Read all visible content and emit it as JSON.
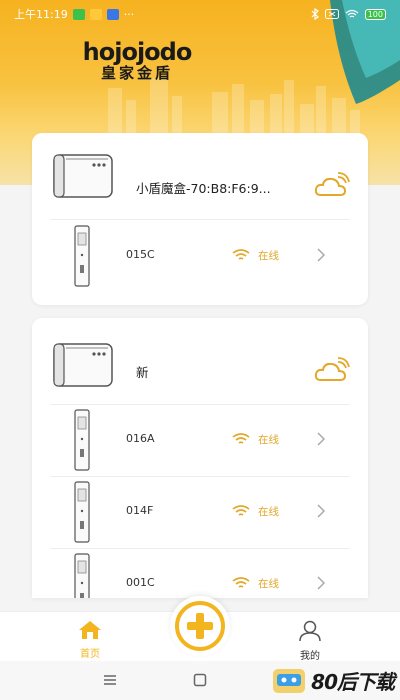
{
  "status_bar": {
    "time": "上午11:19",
    "more": "···",
    "battery": "100"
  },
  "logo": {
    "brand_en": "hojojodo",
    "brand_cn": "皇家金盾"
  },
  "groups": [
    {
      "hub_name": "小盾魔盒-70:B8:F6:9...",
      "devices": [
        {
          "name": "015C",
          "status": "在线"
        }
      ]
    },
    {
      "hub_name": "新",
      "devices": [
        {
          "name": "016A",
          "status": "在线"
        },
        {
          "name": "014F",
          "status": "在线"
        },
        {
          "name": "001C",
          "status": "在线"
        }
      ]
    }
  ],
  "bottom_nav": {
    "home_label": "首页",
    "mine_label": "我的"
  },
  "watermark": {
    "text": "80后下载"
  },
  "colors": {
    "accent": "#f3b51f",
    "status_online": "#e3a82a",
    "home_active": "#f3b51f",
    "header_top": "#f6b21f"
  }
}
